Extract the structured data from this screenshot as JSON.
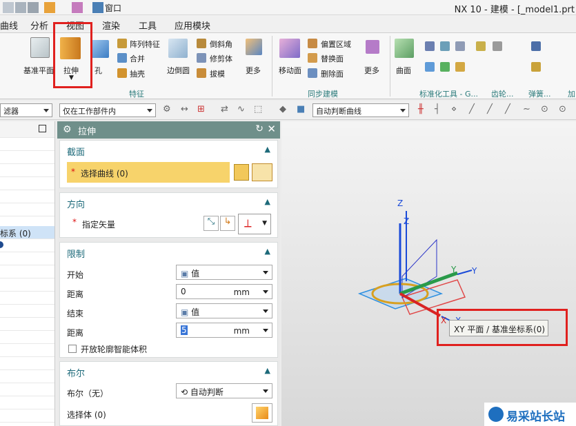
{
  "window": {
    "title": "NX 10 - 建模 - [_model1.prt",
    "window_menu": "窗口"
  },
  "menu": [
    "曲线",
    "分析",
    "视图",
    "渲染",
    "工具",
    "应用模块"
  ],
  "ribbon": {
    "datum_plane": "基准平面",
    "extrude": "拉伸",
    "hole": "孔",
    "pattern_feature": "阵列特征",
    "combine": "合并",
    "shell": "抽壳",
    "edge_blend": "边倒圆",
    "chamfer": "倒斜角",
    "trim_body": "修剪体",
    "draft": "拔模",
    "more1": "更多",
    "group_feature": "特征",
    "move_face": "移动面",
    "offset_region": "偏置区域",
    "replace_face": "替换面",
    "delete_face": "删除面",
    "more2": "更多",
    "group_sync": "同步建模",
    "surface": "曲面",
    "group_std": "标准化工具 - G...",
    "group_gear": "齿轮...",
    "group_spring": "弹簧...",
    "group_more": "加"
  },
  "filterbar": {
    "filter": "滤器",
    "scope": "仅在工作部件内",
    "curve_rule": "自动判断曲线"
  },
  "leftnav": {
    "selected_item": "标系 (0)"
  },
  "dialog": {
    "title": "拉伸",
    "section_header": "截面",
    "select_curve": "选择曲线 (0)",
    "direction_header": "方向",
    "specify_vector": "指定矢量",
    "limits_header": "限制",
    "start_label": "开始",
    "start_value": "值",
    "distance1_label": "距离",
    "distance1_value": "0",
    "unit": "mm",
    "end_label": "结束",
    "end_value": "值",
    "distance2_label": "距离",
    "distance2_value": "5",
    "open_profile": "开放轮廓智能体积",
    "boolean_header": "布尔",
    "boolean_label": "布尔（无）",
    "boolean_value": "自动判断",
    "select_body": "选择体 (0)",
    "required_mark": "*"
  },
  "viewport": {
    "tooltip": "XY 平面 / 基准坐标系(0)",
    "axis_x": "X",
    "axis_y": "Y",
    "axis_z": "Z",
    "watermark": "易采站长站"
  },
  "colors": {
    "highlight": "#e0201e",
    "dialog_title": "#6f8f8a",
    "section_text": "#1d6a7a",
    "selected_row": "#cfe3f7",
    "select_bar": "#f7d36b"
  }
}
